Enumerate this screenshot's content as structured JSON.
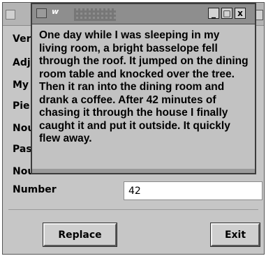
{
  "back_window": {
    "labels": [
      "Ver",
      "Adj",
      "My",
      "Pie",
      "Nou",
      "Pas",
      "Nou"
    ],
    "number_label": "Number",
    "number_value": "42",
    "replace_button": "Replace",
    "exit_button": "Exit"
  },
  "front_window": {
    "title": "w",
    "window_buttons": {
      "minimize": "_",
      "maximize": "□",
      "close": "x"
    },
    "message": "One day while I was sleeping in my living room, a bright basselope fell through the roof. It jumped on the dining room table and knocked over the tree. Then it ran into the dining room and drank a coffee. After 42 minutes of chasing it through the house I finally caught it and put it outside. It quickly flew away."
  }
}
